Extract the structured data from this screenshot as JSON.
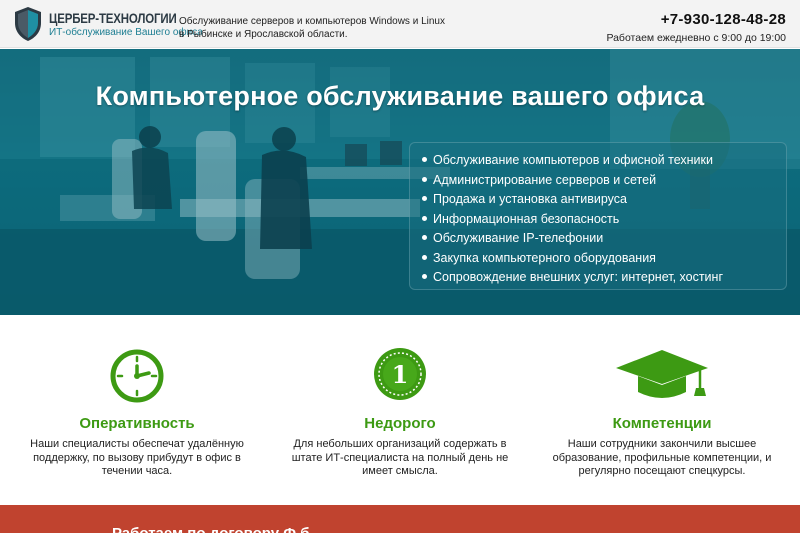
{
  "header": {
    "logo_title": "ЦЕРБЕР-ТЕХНОЛОГИИ",
    "logo_subtitle": "ИТ-обслуживание Вашего офиса",
    "tagline_line1": "Обслуживание серверов и компьютеров Windows и Linux",
    "tagline_line2": "в Рыбинске и Ярославской области.",
    "phone": "+7-930-128-48-28",
    "hours": "Работаем ежедневно с 9:00 до 19:00"
  },
  "hero": {
    "title": "Компьютерное обслуживание вашего офиса",
    "services": [
      "Обслуживание компьютеров и офисной техники",
      "Администрирование серверов и сетей",
      "Продажа и установка антивируса",
      "Информационная безопасность",
      "Обслуживание IP-телефонии",
      "Закупка компьютерного оборудования",
      "Сопровождение внешних услуг: интернет, хостинг"
    ]
  },
  "features": [
    {
      "icon": "clock-icon",
      "title": "Оперативность",
      "desc_line1": "Наши специалисты обеспечат удалённую",
      "desc_line2": "поддержку, по вызову прибудут в офис в",
      "desc_line3": "течении часа."
    },
    {
      "icon": "coin-icon",
      "coin_value": "1",
      "title": "Недорого",
      "desc_line1": "Для небольших организаций содержать в",
      "desc_line2": "штате ИТ-специалиста на полный день не",
      "desc_line3": "имеет смысла."
    },
    {
      "icon": "graduation-cap-icon",
      "title": "Компетенции",
      "desc_line1": "Наши сотрудники закончили высшее",
      "desc_line2": "образование, профильные компетенции, и",
      "desc_line3": "регулярно посещают спецкурсы."
    }
  ],
  "band": {
    "text": "Работаем по договору Ф                          б"
  },
  "colors": {
    "accent_green": "#3d9a13",
    "hero_teal": "#0e7183",
    "band_red": "#c0432f"
  }
}
